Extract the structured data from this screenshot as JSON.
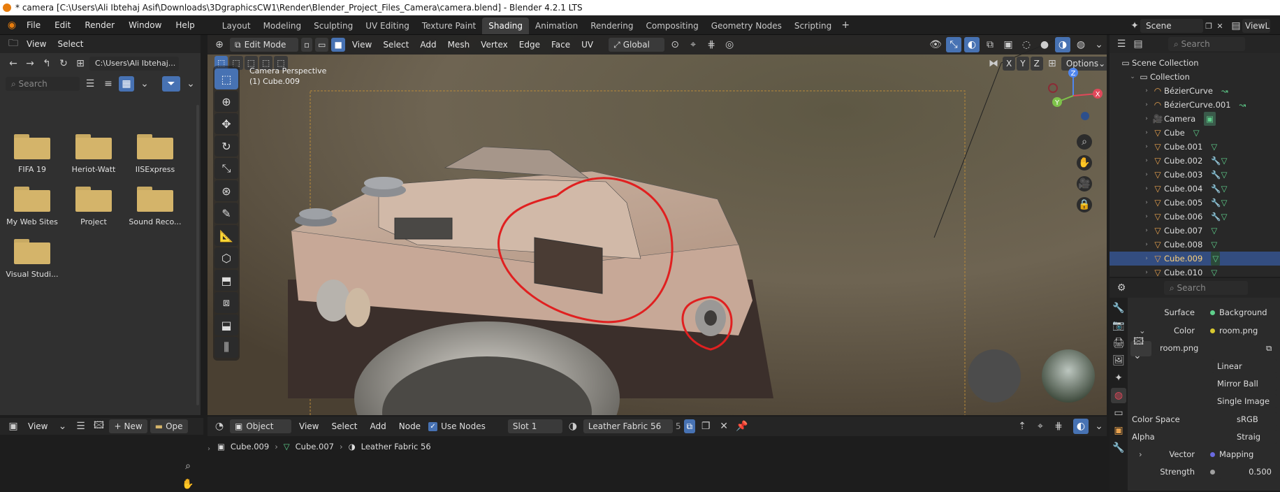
{
  "window": {
    "title": "* camera [C:\\Users\\Ali Ibtehaj Asif\\Downloads\\3DgraphicsCW1\\Render\\Blender_Project_Files_Camera\\camera.blend] - Blender 4.2.1 LTS"
  },
  "menu": [
    "File",
    "Edit",
    "Render",
    "Window",
    "Help"
  ],
  "workspaces": [
    "Layout",
    "Modeling",
    "Sculpting",
    "UV Editing",
    "Texture Paint",
    "Shading",
    "Animation",
    "Rendering",
    "Compositing",
    "Geometry Nodes",
    "Scripting"
  ],
  "active_workspace": "Shading",
  "scene": {
    "name": "Scene",
    "view_layer": "ViewL"
  },
  "file_browser": {
    "menu": [
      "View",
      "Select"
    ],
    "path": "C:\\Users\\Ali Ibtehaj...",
    "search_placeholder": "Search",
    "folders": [
      "FIFA 19",
      "Heriot-Watt",
      "IISExpress",
      "My Web Sites",
      "Project",
      "Sound Reco...",
      "Visual Studi..."
    ]
  },
  "image_editor": {
    "menu": "View",
    "new_label": "New",
    "open_label": "Ope"
  },
  "viewport": {
    "mode": "Edit Mode",
    "menu": [
      "View",
      "Select",
      "Add",
      "Mesh",
      "Vertex",
      "Edge",
      "Face",
      "UV"
    ],
    "orientation": "Global",
    "overlay_line1": "Camera Perspective",
    "overlay_line2": "(1) Cube.009",
    "options_label": "Options",
    "axis": [
      "X",
      "Y",
      "Z"
    ],
    "gizmo": {
      "x": "X",
      "y": "Y",
      "z": "Z"
    }
  },
  "shader_editor": {
    "type": "Object",
    "menu": [
      "View",
      "Select",
      "Add",
      "Node"
    ],
    "use_nodes_label": "Use Nodes",
    "slot": "Slot 1",
    "material": "Leather Fabric 56",
    "users": "5",
    "breadcrumb": [
      "Cube.009",
      "Cube.007",
      "Leather Fabric 56"
    ]
  },
  "outliner": {
    "search_placeholder": "Search",
    "scene_collection": "Scene Collection",
    "collection": "Collection",
    "items": [
      {
        "name": "BézierCurve",
        "type": "curve"
      },
      {
        "name": "BézierCurve.001",
        "type": "curve"
      },
      {
        "name": "Camera",
        "type": "camera"
      },
      {
        "name": "Cube",
        "type": "mesh"
      },
      {
        "name": "Cube.001",
        "type": "mesh"
      },
      {
        "name": "Cube.002",
        "type": "mesh"
      },
      {
        "name": "Cube.003",
        "type": "mesh"
      },
      {
        "name": "Cube.004",
        "type": "mesh"
      },
      {
        "name": "Cube.005",
        "type": "mesh"
      },
      {
        "name": "Cube.006",
        "type": "mesh"
      },
      {
        "name": "Cube.007",
        "type": "mesh"
      },
      {
        "name": "Cube.008",
        "type": "mesh"
      },
      {
        "name": "Cube.009",
        "type": "mesh",
        "selected": true
      },
      {
        "name": "Cube.010",
        "type": "mesh"
      }
    ]
  },
  "properties": {
    "search_placeholder": "Search",
    "surface_label": "Surface",
    "surface_value": "Background",
    "color_label": "Color",
    "color_value": "room.png",
    "image_name": "room.png",
    "interpolation": "Linear",
    "projection": "Mirror Ball",
    "source": "Single Image",
    "color_space_label": "Color Space",
    "color_space_value": "sRGB",
    "alpha_label": "Alpha",
    "alpha_value": "Straig",
    "vector_label": "Vector",
    "vector_value": "Mapping",
    "strength_label": "Strength",
    "strength_value": "0.500"
  },
  "colors": {
    "accent": "#4772b3",
    "selected_row": "#334d80",
    "annotation": "#e02020",
    "folder": "#d4b46a"
  }
}
